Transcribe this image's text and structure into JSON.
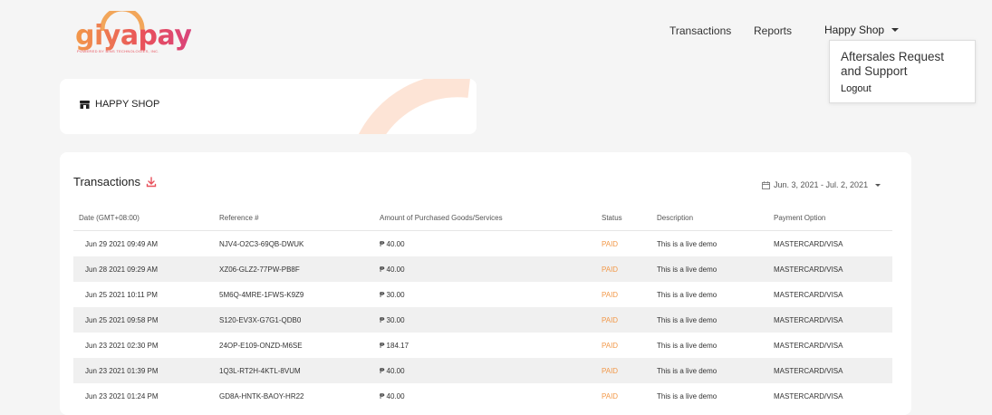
{
  "brand": {
    "logo_text": "giyapay",
    "tagline": "POWERED BY BINS TECHNOLOGIES, INC."
  },
  "nav": {
    "transactions": "Transactions",
    "reports": "Reports",
    "account": "Happy Shop"
  },
  "dropdown": {
    "aftersales": "Aftersales Request and Support",
    "logout": "Logout"
  },
  "shop": {
    "name": "HAPPY SHOP",
    "icon": "store-icon"
  },
  "transactions": {
    "title": "Transactions",
    "download_icon": "download-icon",
    "date_range": "Jun. 3, 2021 - Jul. 2, 2021",
    "columns": [
      "Date (GMT+08:00)",
      "Reference #",
      "Amount of Purchased Goods/Services",
      "Status",
      "Description",
      "Payment Option"
    ],
    "rows": [
      [
        "Jun 29 2021 09:49 AM",
        "NJV4-O2C3-69QB-DWUK",
        "₱ 40.00",
        "PAID",
        "This is a live demo",
        "MASTERCARD/VISA"
      ],
      [
        "Jun 28 2021 09:29 AM",
        "XZ06-GLZ2-77PW-PB8F",
        "₱ 40.00",
        "PAID",
        "This is a live demo",
        "MASTERCARD/VISA"
      ],
      [
        "Jun 25 2021 10:11 PM",
        "5M6Q-4MRE-1FWS-K9Z9",
        "₱ 30.00",
        "PAID",
        "This is a live demo",
        "MASTERCARD/VISA"
      ],
      [
        "Jun 25 2021 09:58 PM",
        "S120-EV3X-G7G1-QDB0",
        "₱ 30.00",
        "PAID",
        "This is a live demo",
        "MASTERCARD/VISA"
      ],
      [
        "Jun 23 2021 02:30 PM",
        "24OP-E109-ONZD-M6SE",
        "₱ 184.17",
        "PAID",
        "This is a live demo",
        "MASTERCARD/VISA"
      ],
      [
        "Jun 23 2021 01:39 PM",
        "1Q3L-RT2H-4KTL-8VUM",
        "₱ 40.00",
        "PAID",
        "This is a live demo",
        "MASTERCARD/VISA"
      ],
      [
        "Jun 23 2021 01:24 PM",
        "GD8A-HNTK-BAOY-HR22",
        "₱ 40.00",
        "PAID",
        "This is a live demo",
        "MASTERCARD/VISA"
      ]
    ]
  },
  "colors": {
    "accent": "#e8505b",
    "status_paid": "#f2994a",
    "page_bg": "#f5f5f5"
  }
}
